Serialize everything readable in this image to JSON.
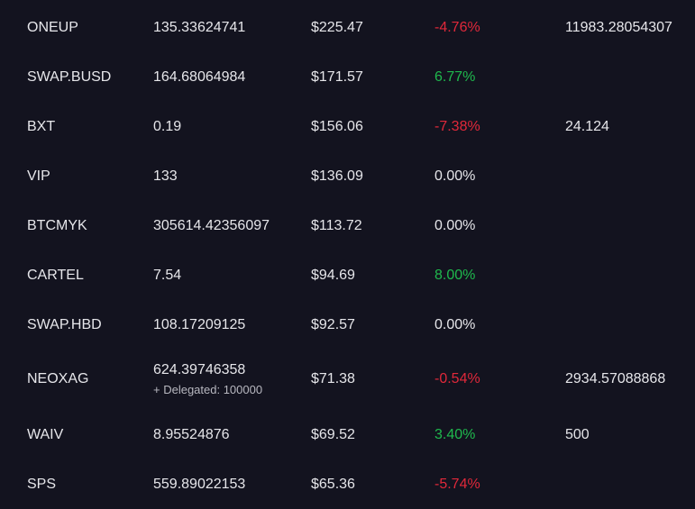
{
  "theme": {
    "background": "#13131f",
    "text": "#e6e6ea",
    "negative": "#e0283a",
    "positive": "#1fb94d"
  },
  "rows": [
    {
      "symbol": "ONEUP",
      "balance": "135.33624741",
      "delegated": "",
      "value": "$225.47",
      "change": "-4.76%",
      "change_dir": "neg",
      "stake": "11983.28054307"
    },
    {
      "symbol": "SWAP.BUSD",
      "balance": "164.68064984",
      "delegated": "",
      "value": "$171.57",
      "change": "6.77%",
      "change_dir": "pos",
      "stake": ""
    },
    {
      "symbol": "BXT",
      "balance": "0.19",
      "delegated": "",
      "value": "$156.06",
      "change": "-7.38%",
      "change_dir": "neg",
      "stake": "24.124"
    },
    {
      "symbol": "VIP",
      "balance": "133",
      "delegated": "",
      "value": "$136.09",
      "change": "0.00%",
      "change_dir": "neu",
      "stake": ""
    },
    {
      "symbol": "BTCMYK",
      "balance": "305614.42356097",
      "delegated": "",
      "value": "$113.72",
      "change": "0.00%",
      "change_dir": "neu",
      "stake": ""
    },
    {
      "symbol": "CARTEL",
      "balance": "7.54",
      "delegated": "",
      "value": "$94.69",
      "change": "8.00%",
      "change_dir": "pos",
      "stake": ""
    },
    {
      "symbol": "SWAP.HBD",
      "balance": "108.17209125",
      "delegated": "",
      "value": "$92.57",
      "change": "0.00%",
      "change_dir": "neu",
      "stake": ""
    },
    {
      "symbol": "NEOXAG",
      "balance": "624.39746358",
      "delegated": "+ Delegated: 100000",
      "value": "$71.38",
      "change": "-0.54%",
      "change_dir": "neg",
      "stake": "2934.57088868"
    },
    {
      "symbol": "WAIV",
      "balance": "8.95524876",
      "delegated": "",
      "value": "$69.52",
      "change": "3.40%",
      "change_dir": "pos",
      "stake": "500"
    },
    {
      "symbol": "SPS",
      "balance": "559.89022153",
      "delegated": "",
      "value": "$65.36",
      "change": "-5.74%",
      "change_dir": "neg",
      "stake": ""
    }
  ]
}
